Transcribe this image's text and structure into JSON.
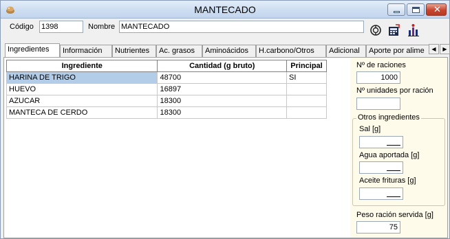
{
  "window": {
    "title": "MANTECADO"
  },
  "header": {
    "codigo_label": "Código",
    "codigo_value": "1398",
    "nombre_label": "Nombre",
    "nombre_value": "MANTECADO",
    "icons": [
      "lifebuoy-icon",
      "calculator-icon",
      "chart-person-icon"
    ]
  },
  "tabs": [
    {
      "label": "Ingredientes",
      "active": true
    },
    {
      "label": "Información"
    },
    {
      "label": "Nutrientes"
    },
    {
      "label": "Ac. grasos"
    },
    {
      "label": "Aminoácidos"
    },
    {
      "label": "H.carbono/Otros"
    },
    {
      "label": "Adicional"
    },
    {
      "label": "Aporte por alime"
    }
  ],
  "grid": {
    "columns": [
      "Ingrediente",
      "Cantidad (g bruto)",
      "Principal"
    ],
    "rows": [
      {
        "ingrediente": "HARINA DE TRIGO",
        "cantidad": "48700",
        "principal": "SI"
      },
      {
        "ingrediente": "HUEVO",
        "cantidad": "16897",
        "principal": ""
      },
      {
        "ingrediente": "AZUCAR",
        "cantidad": "18300",
        "principal": ""
      },
      {
        "ingrediente": "MANTECA DE CERDO",
        "cantidad": "18300",
        "principal": ""
      }
    ]
  },
  "panel": {
    "raciones_label": "Nº de raciones",
    "raciones_value": "1000",
    "unidades_label": "Nº unidades por ración",
    "unidades_value": "",
    "otros_title": "Otros ingredientes",
    "sal_label": "Sal [g]",
    "agua_label": "Agua aportada [g]",
    "aceite_label": "Aceite frituras [g]",
    "peso_label": "Peso ración servida [g]",
    "peso_value": "75"
  },
  "colors": {
    "selection": "#b3cde8",
    "panel_bg": "#fffbea",
    "close_button": "#c8452e"
  }
}
